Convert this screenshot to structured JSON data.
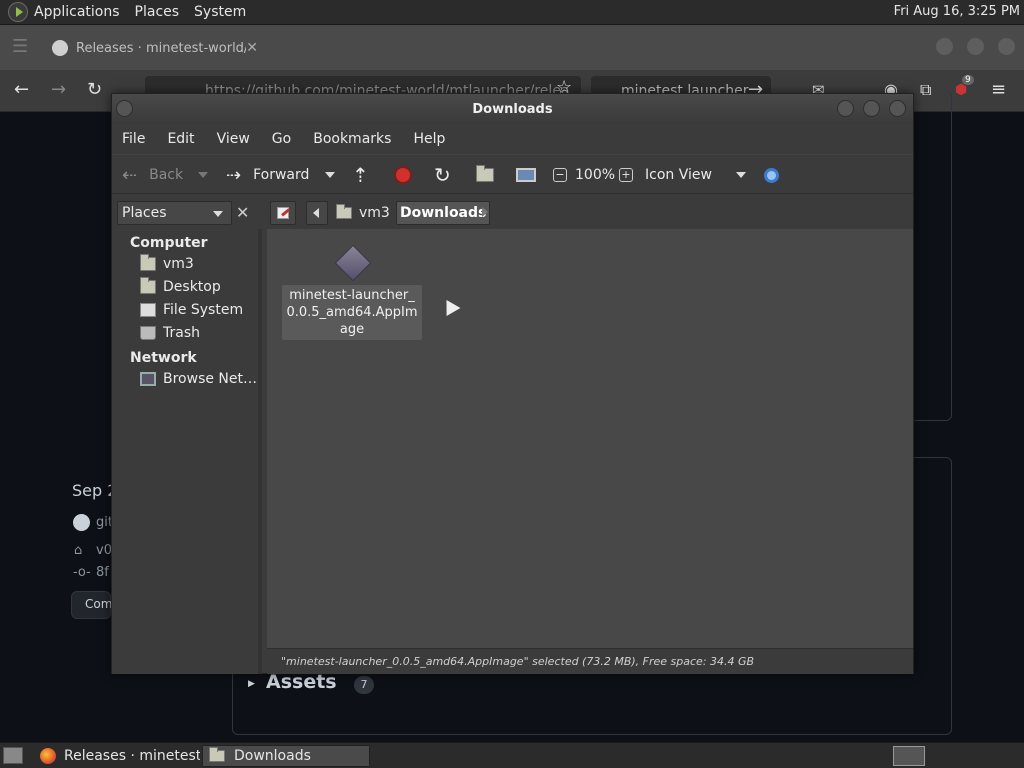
{
  "top_panel": {
    "menus": [
      "Applications",
      "Places",
      "System"
    ],
    "clock": "Fri Aug 16,  3:25 PM"
  },
  "browser": {
    "tab_title": "Releases · minetest-world/",
    "url": "https://github.com/minetest-world/mtlauncher/relea",
    "search_text": "minetest launcher",
    "badge_count": "9",
    "page": {
      "release_date": "Sep 2",
      "author": "git",
      "tag": "v0",
      "commit": "8f",
      "compare_label": "Com",
      "assets_label": "Assets",
      "assets_count": "7"
    }
  },
  "file_manager": {
    "title": "Downloads",
    "menus": [
      "File",
      "Edit",
      "View",
      "Go",
      "Bookmarks",
      "Help"
    ],
    "toolbar": {
      "back": "Back",
      "forward": "Forward",
      "zoom": "100%",
      "view_mode": "Icon View"
    },
    "sidebar_selector": "Places",
    "breadcrumbs": [
      "vm3",
      "Downloads"
    ],
    "sidebar": {
      "computer_heading": "Computer",
      "computer_items": [
        "vm3",
        "Desktop",
        "File System",
        "Trash"
      ],
      "network_heading": "Network",
      "network_items": [
        "Browse Net…"
      ]
    },
    "files": [
      {
        "name": "minetest-launcher_0.0.5_amd64.AppImage",
        "selected": true
      }
    ],
    "status": "\"minetest-launcher_0.0.5_amd64.AppImage\" selected (73.2 MB), Free space: 34.4 GB"
  },
  "taskbar": {
    "tasks": [
      "Releases · minetest-…",
      "Downloads"
    ]
  },
  "icons": {
    "back": "arrow-left-icon",
    "forward": "arrow-right-icon",
    "up": "up-arrow-icon",
    "stop": "stop-icon",
    "reload": "reload-icon",
    "home": "home-folder-icon",
    "computer": "computer-icon",
    "search": "magnifier-icon"
  },
  "colors": {
    "stop_red": "#d0312d",
    "search_blue": "#3a7bd5"
  }
}
